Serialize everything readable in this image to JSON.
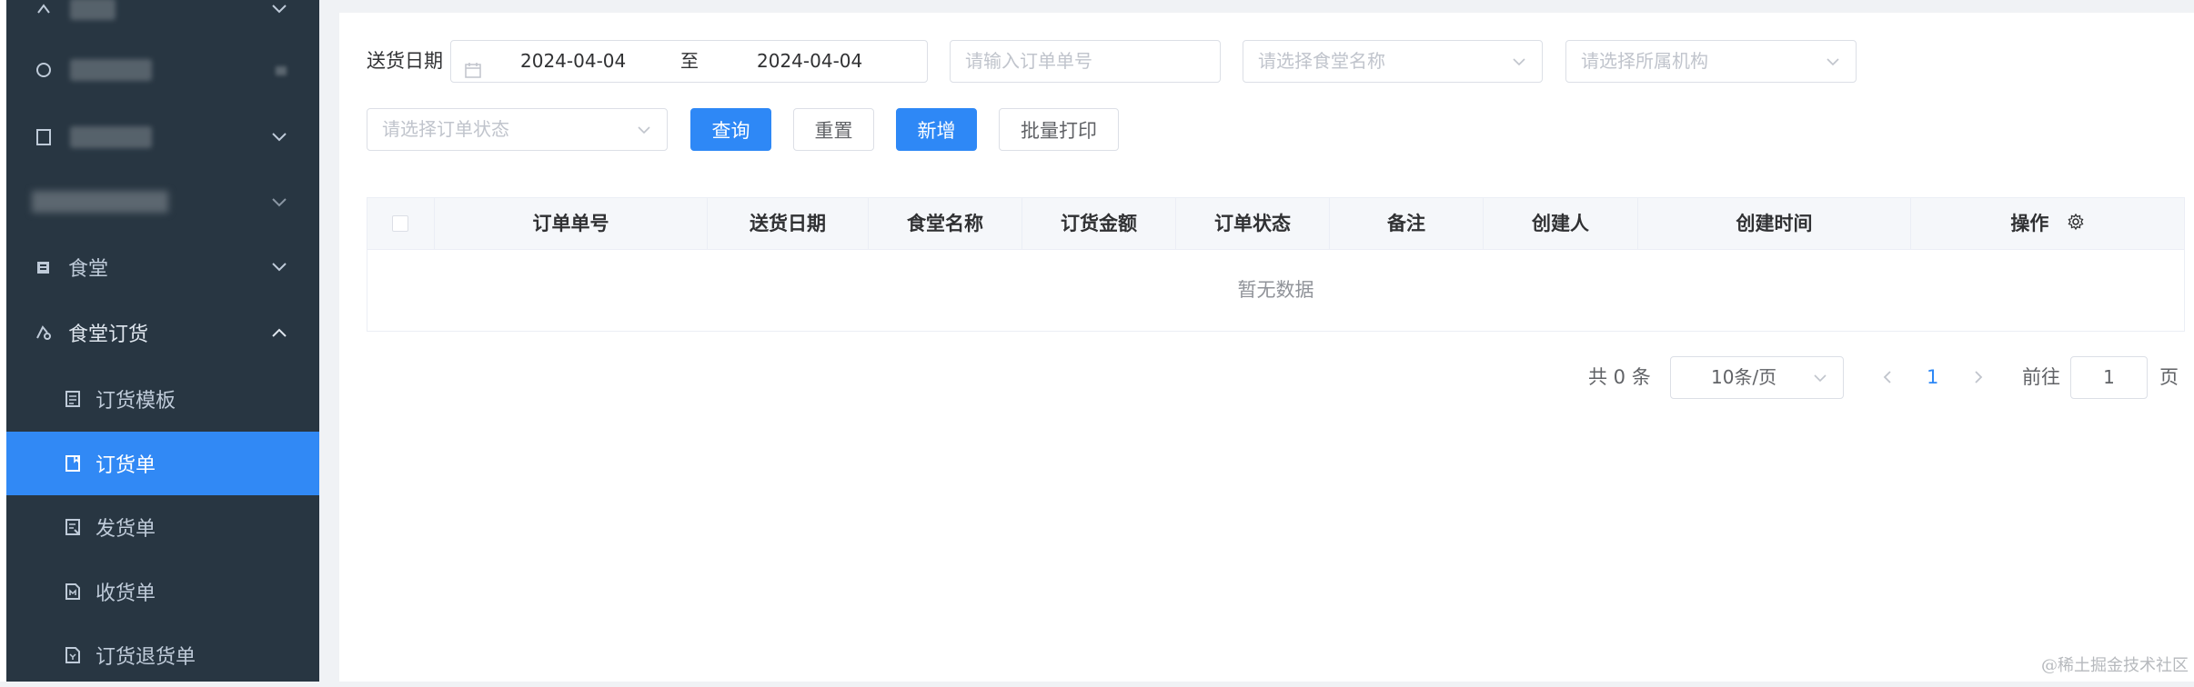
{
  "sidebar": {
    "items": [
      {
        "label": "食堂",
        "icon": "canteen-icon"
      },
      {
        "label": "食堂订货",
        "icon": "order-icon"
      }
    ],
    "sub_items": [
      {
        "label": "订货模板",
        "icon": "template-icon"
      },
      {
        "label": "订货单",
        "icon": "order-doc-icon",
        "active": true
      },
      {
        "label": "发货单",
        "icon": "ship-doc-icon"
      },
      {
        "label": "收货单",
        "icon": "receive-doc-icon"
      },
      {
        "label": "订货退货单",
        "icon": "return-doc-icon"
      }
    ]
  },
  "filters": {
    "date_label": "送货日期",
    "date_start": "2024-04-04",
    "date_sep": "至",
    "date_end": "2024-04-04",
    "order_no_placeholder": "请输入订单单号",
    "canteen_placeholder": "请选择食堂名称",
    "org_placeholder": "请选择所属机构",
    "status_placeholder": "请选择订单状态"
  },
  "buttons": {
    "query": "查询",
    "reset": "重置",
    "add": "新增",
    "batch_print": "批量打印"
  },
  "table": {
    "columns": [
      "订单单号",
      "送货日期",
      "食堂名称",
      "订货金额",
      "订单状态",
      "备注",
      "创建人",
      "创建时间",
      "操作"
    ],
    "empty_text": "暂无数据"
  },
  "pagination": {
    "total": "共 0 条",
    "page_size": "10条/页",
    "current_page": "1",
    "goto_label": "前往",
    "goto_value": "1",
    "page_suffix": "页"
  },
  "watermark": "@稀土掘金技术社区",
  "colors": {
    "sidebar_bg": "#283642",
    "active_bg": "#3189f5",
    "primary": "#2e88f6",
    "sidebar_text": "#bfcbd9"
  }
}
